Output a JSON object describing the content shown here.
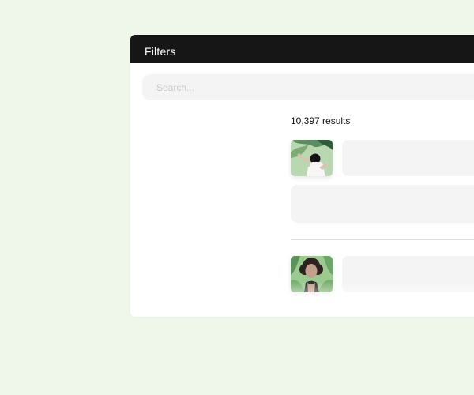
{
  "page": {
    "background_color": "#eef7ea"
  },
  "header": {
    "title": "Filters",
    "background_color": "#161616"
  },
  "search": {
    "placeholder": "Search...",
    "value": ""
  },
  "results": {
    "count_label": "10,397 results",
    "items": [
      {
        "thumbnail_icon": "portrait-thumbnail",
        "subject": "person with arm raised",
        "placeholder_blocks": 2
      },
      {
        "thumbnail_icon": "portrait-thumbnail",
        "subject": "person with curly hair",
        "placeholder_blocks": 1
      }
    ]
  },
  "colors": {
    "panel": "#ffffff",
    "placeholder": "#f4f4f4",
    "divider": "#dedede",
    "text": "#111111"
  }
}
